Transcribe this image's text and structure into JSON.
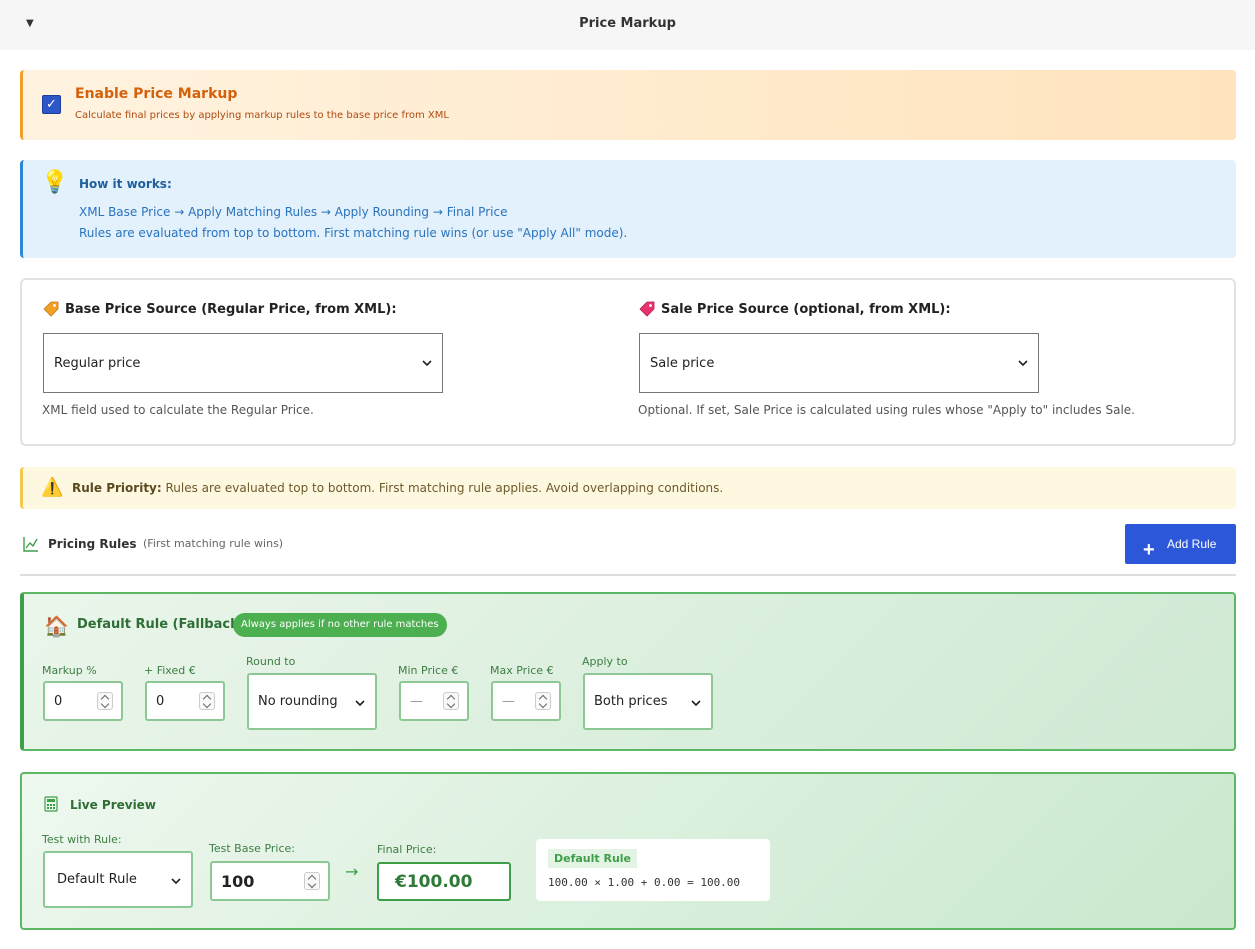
{
  "header": {
    "title": "Price Markup"
  },
  "enable": {
    "checked": true,
    "title": "Enable Price Markup",
    "description": "Calculate final prices by applying markup rules to the base price from XML"
  },
  "how_it_works": {
    "title": "How it works:",
    "line1": "XML Base Price → Apply Matching Rules → Apply Rounding → Final Price",
    "line2": "Rules are evaluated from top to bottom. First matching rule wins (or use \"Apply All\" mode)."
  },
  "sources": {
    "base": {
      "label": "Base Price Source (Regular Price, from XML):",
      "selected": "Regular price",
      "help": "XML field used to calculate the Regular Price.",
      "icon": "price-tag-icon",
      "color": "#f0a028"
    },
    "sale": {
      "label": "Sale Price Source (optional, from XML):",
      "selected": "Sale price",
      "help": "Optional. If set, Sale Price is calculated using rules whose \"Apply to\" includes Sale.",
      "icon": "price-tag-icon",
      "color": "#e8336b"
    }
  },
  "priority": {
    "label": "Rule Priority:",
    "text": " Rules are evaluated top to bottom. First matching rule applies. Avoid overlapping conditions."
  },
  "rules": {
    "title": "Pricing Rules",
    "subtitle": "(First matching rule wins)",
    "add_label": "Add Rule",
    "add_icon": "plus-icon"
  },
  "default_rule": {
    "title": "Default Rule (Fallback)",
    "badge": "Always applies if no other rule matches",
    "fields": {
      "markup_label": "Markup %",
      "markup_value": "0",
      "fixed_label": "+ Fixed €",
      "fixed_value": "0",
      "round_label": "Round to",
      "round_value": "No rounding",
      "min_label": "Min Price €",
      "min_placeholder": "—",
      "max_label": "Max Price €",
      "max_placeholder": "—",
      "apply_label": "Apply to",
      "apply_value": "Both prices"
    }
  },
  "preview": {
    "title": "Live Preview",
    "rule_label": "Test with Rule:",
    "rule_value": "Default Rule",
    "base_label": "Test Base Price:",
    "base_value": "100",
    "final_label": "Final Price:",
    "final_value": "€100.00",
    "formula_title": "Default Rule",
    "formula": "100.00 × 1.00 + 0.00 = 100.00"
  },
  "colors": {
    "accent_blue": "#2c57d8",
    "success_green": "#3e9f48",
    "warning_orange": "#f0a028",
    "info_blue": "#2f86d6"
  }
}
